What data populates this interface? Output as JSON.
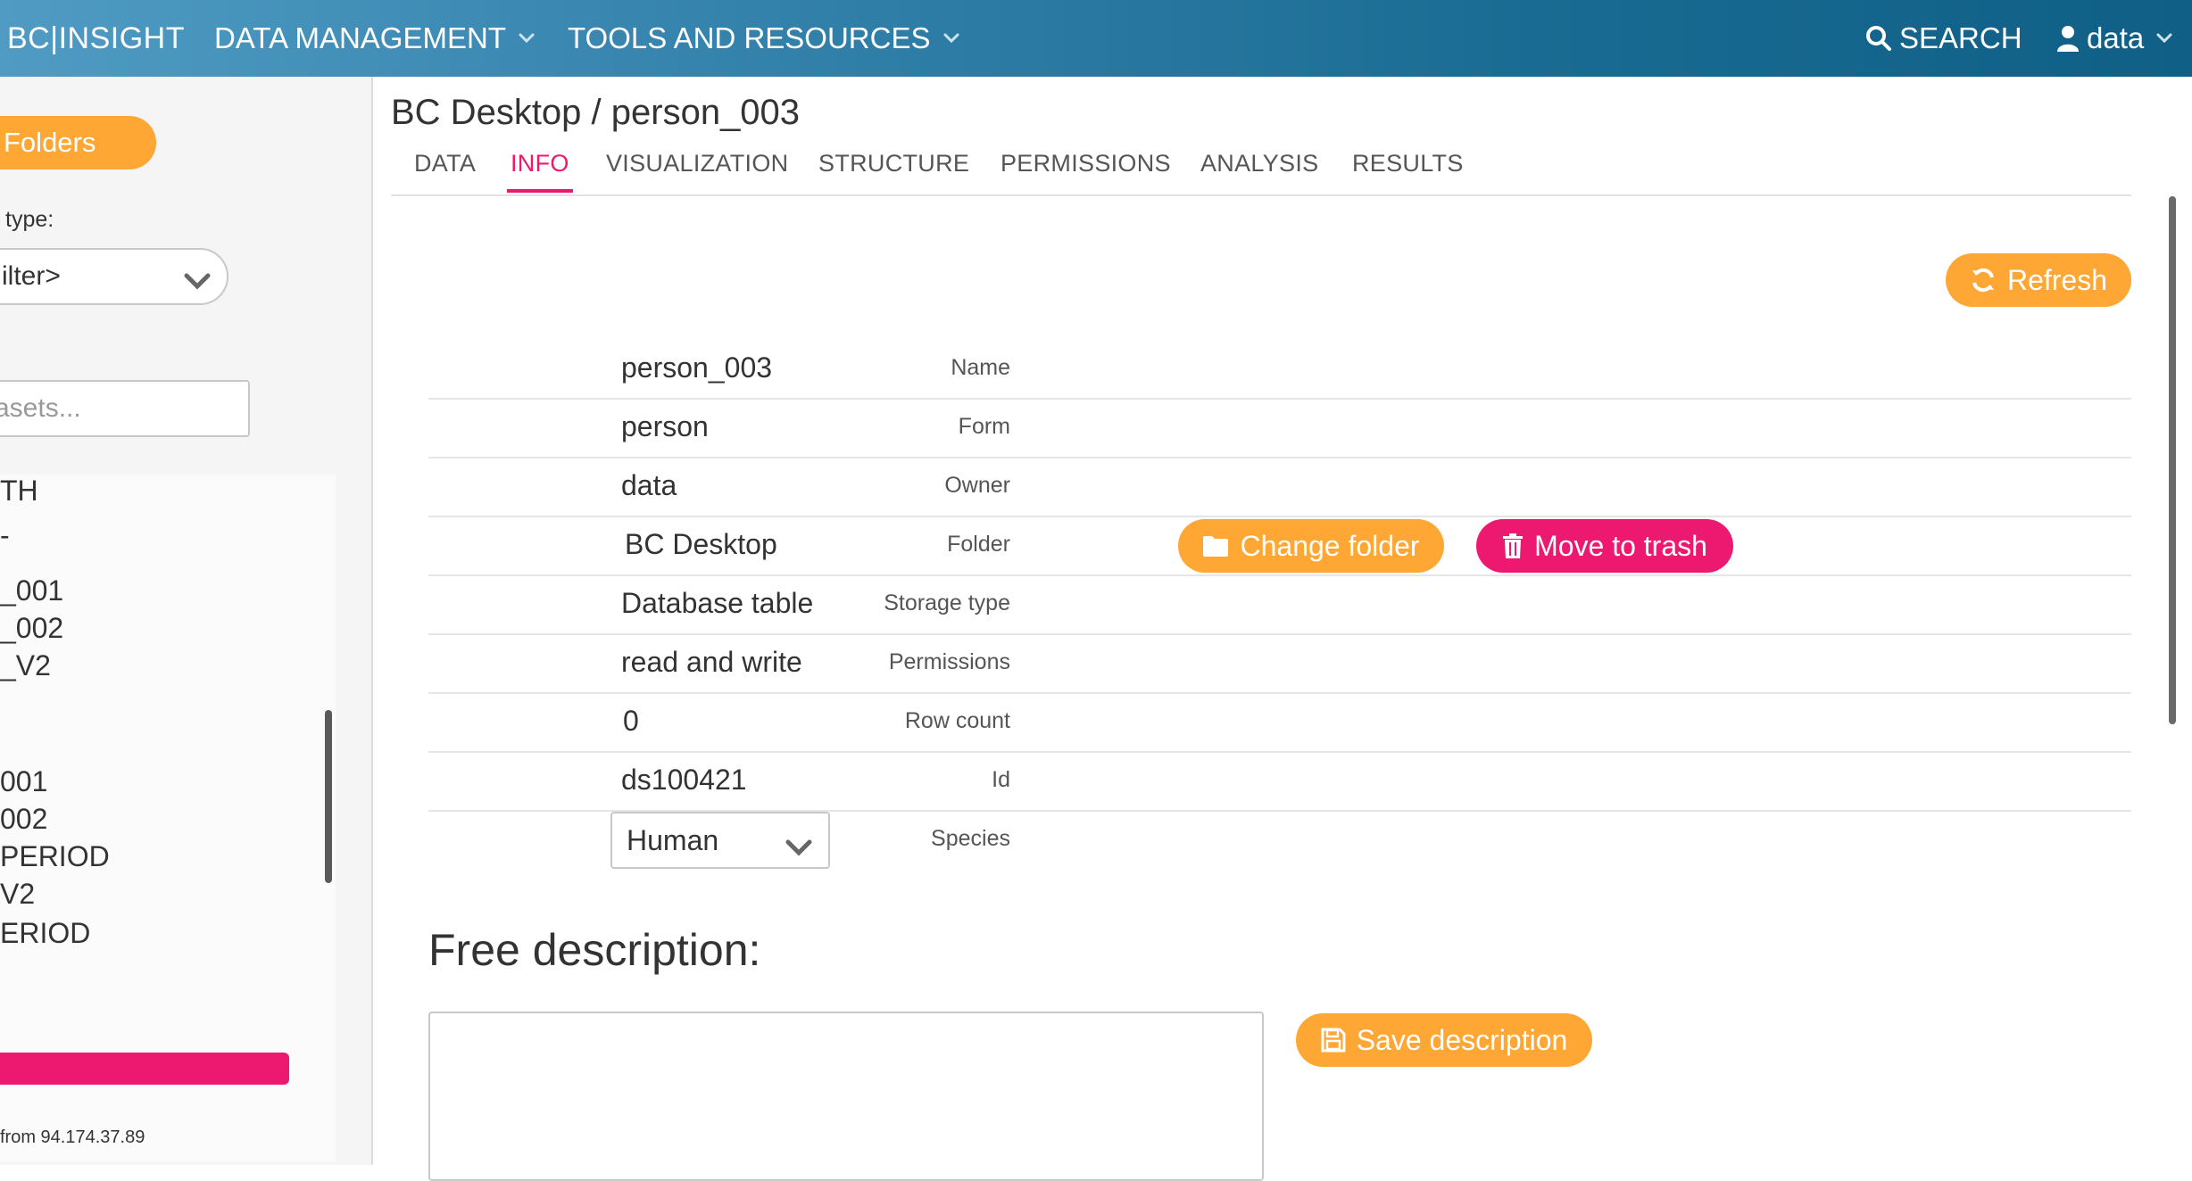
{
  "navbar": {
    "brand": "BC|INSIGHT",
    "data_management": "DATA MANAGEMENT",
    "tools_resources": "TOOLS AND RESOURCES",
    "search": "SEARCH",
    "user": "data"
  },
  "sidebar": {
    "folders_label": "Folders",
    "type_label": "type:",
    "type_select_value": "ilter>",
    "search_placeholder": "asets...",
    "items": [
      "TH",
      "-",
      "_001",
      "_002",
      "_V2",
      "001",
      "002",
      "PERIOD",
      "V2",
      "ERIOD"
    ],
    "footer_text": "from 94.174.37.89"
  },
  "page": {
    "title": "BC Desktop / person_003",
    "tabs": [
      "DATA",
      "INFO",
      "VISUALIZATION",
      "STRUCTURE",
      "PERMISSIONS",
      "ANALYSIS",
      "RESULTS"
    ],
    "active_tab": "INFO"
  },
  "actions": {
    "refresh": "Refresh",
    "change_folder": "Change folder",
    "move_to_trash": "Move to trash",
    "save_description": "Save description"
  },
  "info": {
    "rows": [
      {
        "label": "Name",
        "value": "person_003"
      },
      {
        "label": "Form",
        "value": "person"
      },
      {
        "label": "Owner",
        "value": "data"
      },
      {
        "label": "Folder",
        "value": "BC Desktop"
      },
      {
        "label": "Storage type",
        "value": "Database table"
      },
      {
        "label": "Permissions",
        "value": "read and write"
      },
      {
        "label": "Row count",
        "value": "0"
      },
      {
        "label": "Id",
        "value": "ds100421"
      },
      {
        "label": "Species",
        "value": "Human"
      }
    ]
  },
  "description": {
    "title": "Free description:",
    "value": ""
  },
  "colors": {
    "accent_orange": "#fea735",
    "accent_pink": "#ed186f",
    "navbar_start": "#4f9bc4",
    "navbar_end": "#0f5f87"
  },
  "icons": [
    "search-icon",
    "user-icon",
    "chevron-down-icon",
    "refresh-icon",
    "folder-icon",
    "trash-icon",
    "save-icon"
  ]
}
